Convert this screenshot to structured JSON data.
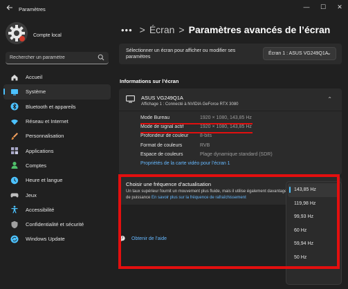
{
  "window": {
    "title": "Paramètres",
    "back_icon": "arrow-left-icon",
    "controls": {
      "minimize": "—",
      "maximize": "☐",
      "close": "✕"
    }
  },
  "account": {
    "name": "Compte local"
  },
  "search": {
    "placeholder": "Rechercher un paramètre",
    "icon": "search-icon"
  },
  "sidebar": {
    "items": [
      {
        "label": "Accueil",
        "icon": "home-icon",
        "color": "#d9d9d9",
        "active": false
      },
      {
        "label": "Système",
        "icon": "system-icon",
        "color": "#4cc2ff",
        "active": true
      },
      {
        "label": "Bluetooth et appareils",
        "icon": "bluetooth-icon",
        "color": "#4cc2ff",
        "active": false
      },
      {
        "label": "Réseau et Internet",
        "icon": "wifi-icon",
        "color": "#4cc2ff",
        "active": false
      },
      {
        "label": "Personnalisation",
        "icon": "brush-icon",
        "color": "#f0a060",
        "active": false
      },
      {
        "label": "Applications",
        "icon": "apps-icon",
        "color": "#a8a8c8",
        "active": false
      },
      {
        "label": "Comptes",
        "icon": "person-icon",
        "color": "#4fc06a",
        "active": false
      },
      {
        "label": "Heure et langue",
        "icon": "globe-clock-icon",
        "color": "#4cc2ff",
        "active": false
      },
      {
        "label": "Jeux",
        "icon": "gamepad-icon",
        "color": "#bfbfbf",
        "active": false
      },
      {
        "label": "Accessibilité",
        "icon": "accessibility-icon",
        "color": "#4cc2ff",
        "active": false
      },
      {
        "label": "Confidentialité et sécurité",
        "icon": "shield-icon",
        "color": "#a0a0a0",
        "active": false
      },
      {
        "label": "Windows Update",
        "icon": "update-icon",
        "color": "#4cc2ff",
        "active": false
      }
    ]
  },
  "breadcrumb": {
    "dots": "•••",
    "separator": ">",
    "parent": "Écran",
    "current": "Paramètres avancés de l’écran"
  },
  "display_select": {
    "label": "Sélectionner un écran pour afficher ou modifier ses paramètres",
    "value": "Écran 1 : ASUS VG249Q1A"
  },
  "info_section": {
    "title": "Informations sur l’écran",
    "monitor_name": "ASUS VG249Q1A",
    "monitor_sub": "Affichage 1 : Connecté à NVIDIA GeForce RTX 3080",
    "rows": [
      {
        "key": "Mode Bureau",
        "value": "1920 × 1080, 143,85 Hz"
      },
      {
        "key": "Mode de signal actif",
        "value": "1920 × 1080, 143,85 Hz"
      },
      {
        "key": "Profondeur de couleur",
        "value": "8-bits"
      },
      {
        "key": "Format de couleurs",
        "value": "RVB"
      },
      {
        "key": "Espace de couleurs",
        "value": "Plage dynamique standard (SDR)"
      }
    ],
    "adapter_link": "Propriétés de la carte vidéo pour l’écran 1"
  },
  "refresh": {
    "title": "Choisir une fréquence d’actualisation",
    "desc": "Un taux supérieur fournit un mouvement plus fluide, mais il utilise également davantage de puissance",
    "desc_link": "En savoir plus sur la fréquence de rafraîchissement",
    "options": [
      "143,85 Hz",
      "119,98 Hz",
      "99,93 Hz",
      "60 Hz",
      "59,94 Hz",
      "50 Hz"
    ],
    "selected_index": 0
  },
  "help": {
    "label": "Obtenir de l’aide"
  },
  "accent_color": "#4cc2ff",
  "highlight_color": "#e30f0f"
}
